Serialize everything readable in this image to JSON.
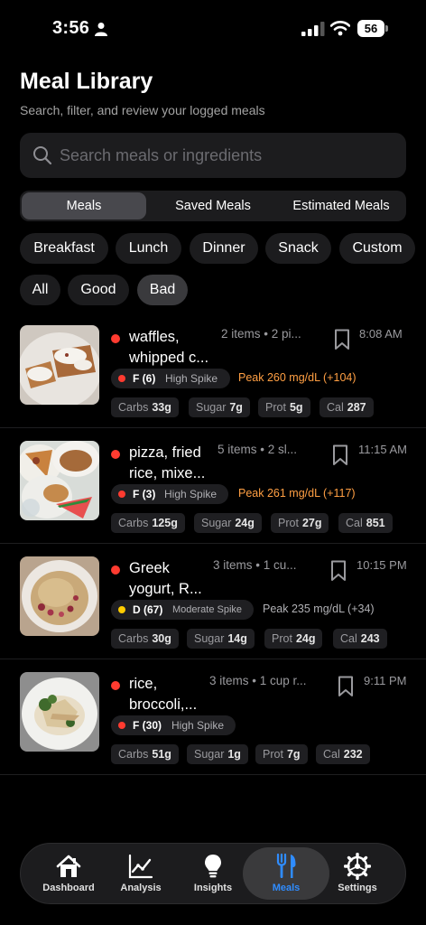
{
  "status_bar": {
    "time": "3:56",
    "battery": "56"
  },
  "header": {
    "title": "Meal Library",
    "subtitle": "Search, filter, and review your logged meals"
  },
  "search": {
    "placeholder": "Search meals or ingredients",
    "value": ""
  },
  "segments": [
    "Meals",
    "Saved Meals",
    "Estimated Meals"
  ],
  "active_segment": "Meals",
  "meal_type_filters": [
    "Breakfast",
    "Lunch",
    "Dinner",
    "Snack",
    "Custom"
  ],
  "quality_filters": [
    "All",
    "Good",
    "Bad"
  ],
  "active_quality_filter": "Bad",
  "colors": {
    "bad_grade": "#ff3b30",
    "moderate_grade": "#ffcc00",
    "high_spike_peak": "#ff9f43",
    "moderate_peak": "#b0b0b4",
    "active_tab": "#2f8cff"
  },
  "meals": [
    {
      "name_line1": "waffles,",
      "name_line2": "whipped c...",
      "items": "2 items • 2 pi...",
      "time": "8:08 AM",
      "grade": "F (6)",
      "spike": "High Spike",
      "peak": "Peak 260 mg/dL (+104)",
      "carbs_label": "Carbs",
      "carbs": "33g",
      "sugar_label": "Sugar",
      "sugar": "7g",
      "prot_label": "Prot",
      "prot": "5g",
      "cal_label": "Cal",
      "cal": "287"
    },
    {
      "name_line1": "pizza, fried",
      "name_line2": "rice, mixe...",
      "items": "5 items • 2 sl...",
      "time": "11:15 AM",
      "grade": "F (3)",
      "spike": "High Spike",
      "peak": "Peak 261 mg/dL (+117)",
      "carbs_label": "Carbs",
      "carbs": "125g",
      "sugar_label": "Sugar",
      "sugar": "24g",
      "prot_label": "Prot",
      "prot": "27g",
      "cal_label": "Cal",
      "cal": "851"
    },
    {
      "name_line1": "Greek",
      "name_line2": "yogurt, R...",
      "items": "3 items • 1 cu...",
      "time": "10:15 PM",
      "grade": "D (67)",
      "spike": "Moderate Spike",
      "peak": "Peak 235 mg/dL (+34)",
      "carbs_label": "Carbs",
      "carbs": "30g",
      "sugar_label": "Sugar",
      "sugar": "14g",
      "prot_label": "Prot",
      "prot": "24g",
      "cal_label": "Cal",
      "cal": "243"
    },
    {
      "name_line1": "rice,",
      "name_line2": "broccoli,...",
      "items": "3 items • 1 cup r...",
      "time": "9:11 PM",
      "grade": "F (30)",
      "spike": "High Spike",
      "peak": "",
      "carbs_label": "Carbs",
      "carbs": "51g",
      "sugar_label": "Sugar",
      "sugar": "1g",
      "prot_label": "Prot",
      "prot": "7g",
      "cal_label": "Cal",
      "cal": "232"
    }
  ],
  "tabs": [
    {
      "label": "Dashboard",
      "icon": "house-icon"
    },
    {
      "label": "Analysis",
      "icon": "line-chart-icon"
    },
    {
      "label": "Insights",
      "icon": "lightbulb-icon"
    },
    {
      "label": "Meals",
      "icon": "fork-knife-icon"
    },
    {
      "label": "Settings",
      "icon": "gear-icon"
    }
  ],
  "active_tab": "Meals"
}
